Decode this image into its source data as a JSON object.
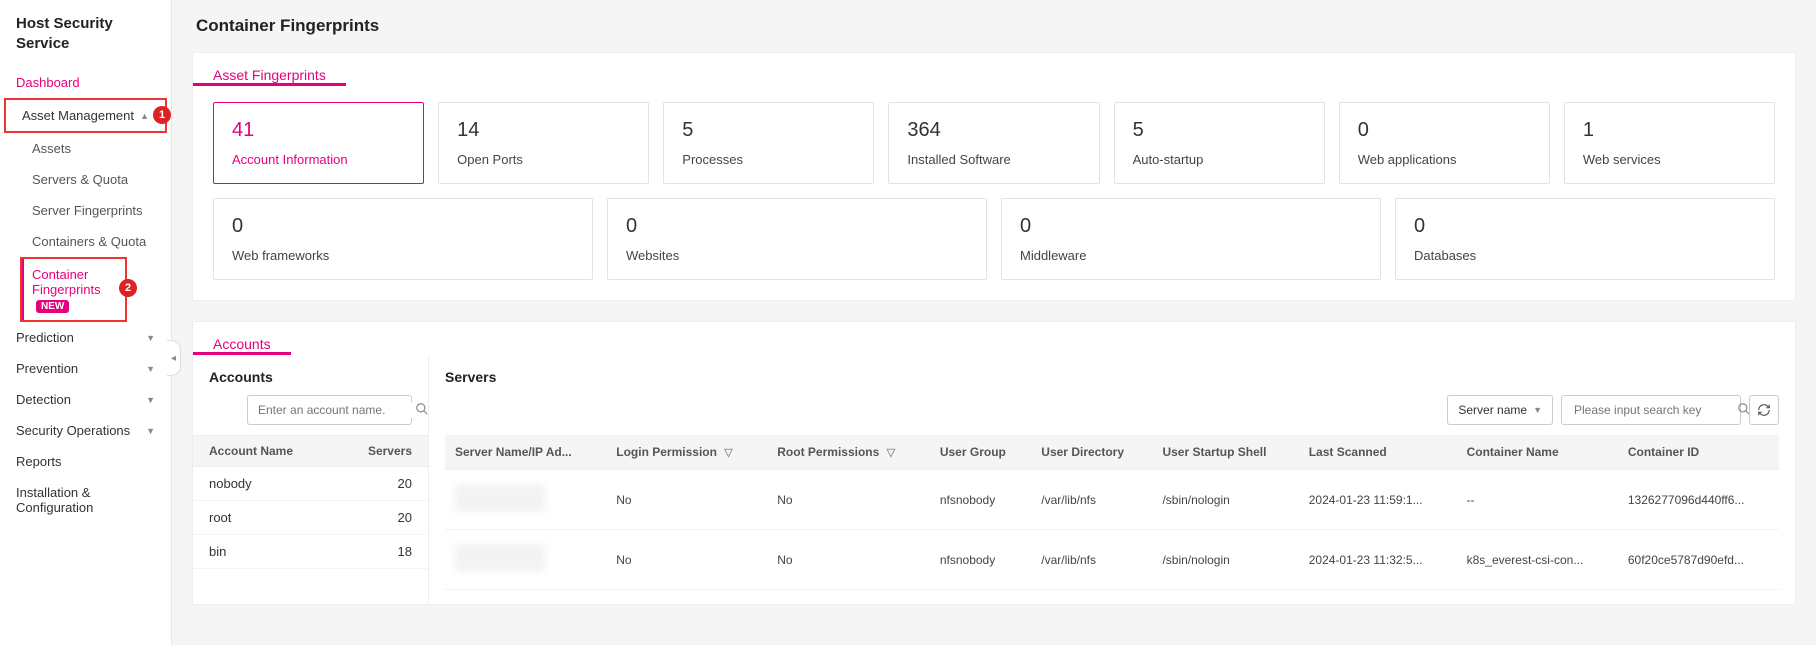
{
  "sidebar": {
    "title": "Host Security Service",
    "items": {
      "dashboard": "Dashboard",
      "asset_management": "Asset Management",
      "prediction": "Prediction",
      "prevention": "Prevention",
      "detection": "Detection",
      "security_operations": "Security Operations",
      "reports": "Reports",
      "installation": "Installation & Configuration"
    },
    "asset_sub": {
      "assets": "Assets",
      "servers_quota": "Servers & Quota",
      "server_fingerprints": "Server Fingerprints",
      "containers_quota": "Containers & Quota",
      "container_fingerprints": "Container Fingerprints",
      "new_badge": "NEW"
    },
    "callout1": "1",
    "callout2": "2"
  },
  "page": {
    "title": "Container Fingerprints"
  },
  "asset_fp": {
    "title": "Asset Fingerprints",
    "cards": [
      {
        "count": "41",
        "label": "Account Information",
        "active": true
      },
      {
        "count": "14",
        "label": "Open Ports"
      },
      {
        "count": "5",
        "label": "Processes"
      },
      {
        "count": "364",
        "label": "Installed Software"
      },
      {
        "count": "5",
        "label": "Auto-startup"
      },
      {
        "count": "0",
        "label": "Web applications"
      },
      {
        "count": "1",
        "label": "Web services"
      },
      {
        "count": "0",
        "label": "Web frameworks"
      },
      {
        "count": "0",
        "label": "Websites"
      },
      {
        "count": "0",
        "label": "Middleware"
      },
      {
        "count": "0",
        "label": "Databases"
      }
    ]
  },
  "accounts": {
    "title": "Accounts",
    "left_title": "Accounts",
    "right_title": "Servers",
    "search_placeholder": "Enter an account name.",
    "col_name": "Account Name",
    "col_servers": "Servers",
    "rows": [
      {
        "name": "nobody",
        "count": "20"
      },
      {
        "name": "root",
        "count": "20"
      },
      {
        "name": "bin",
        "count": "18"
      }
    ],
    "toolbar": {
      "select_label": "Server name",
      "search_placeholder": "Please input search key"
    },
    "srv_cols": {
      "server": "Server Name/IP Ad...",
      "login": "Login Permission",
      "root": "Root Permissions",
      "group": "User Group",
      "dir": "User Directory",
      "shell": "User Startup Shell",
      "scanned": "Last Scanned",
      "cname": "Container Name",
      "cid": "Container ID"
    },
    "srv_rows": [
      {
        "login": "No",
        "root": "No",
        "group": "nfsnobody",
        "dir": "/var/lib/nfs",
        "shell": "/sbin/nologin",
        "scanned": "2024-01-23 11:59:1...",
        "cname": "--",
        "cid": "1326277096d440ff6..."
      },
      {
        "login": "No",
        "root": "No",
        "group": "nfsnobody",
        "dir": "/var/lib/nfs",
        "shell": "/sbin/nologin",
        "scanned": "2024-01-23 11:32:5...",
        "cname": "k8s_everest-csi-con...",
        "cid": "60f20ce5787d90efd..."
      }
    ]
  }
}
